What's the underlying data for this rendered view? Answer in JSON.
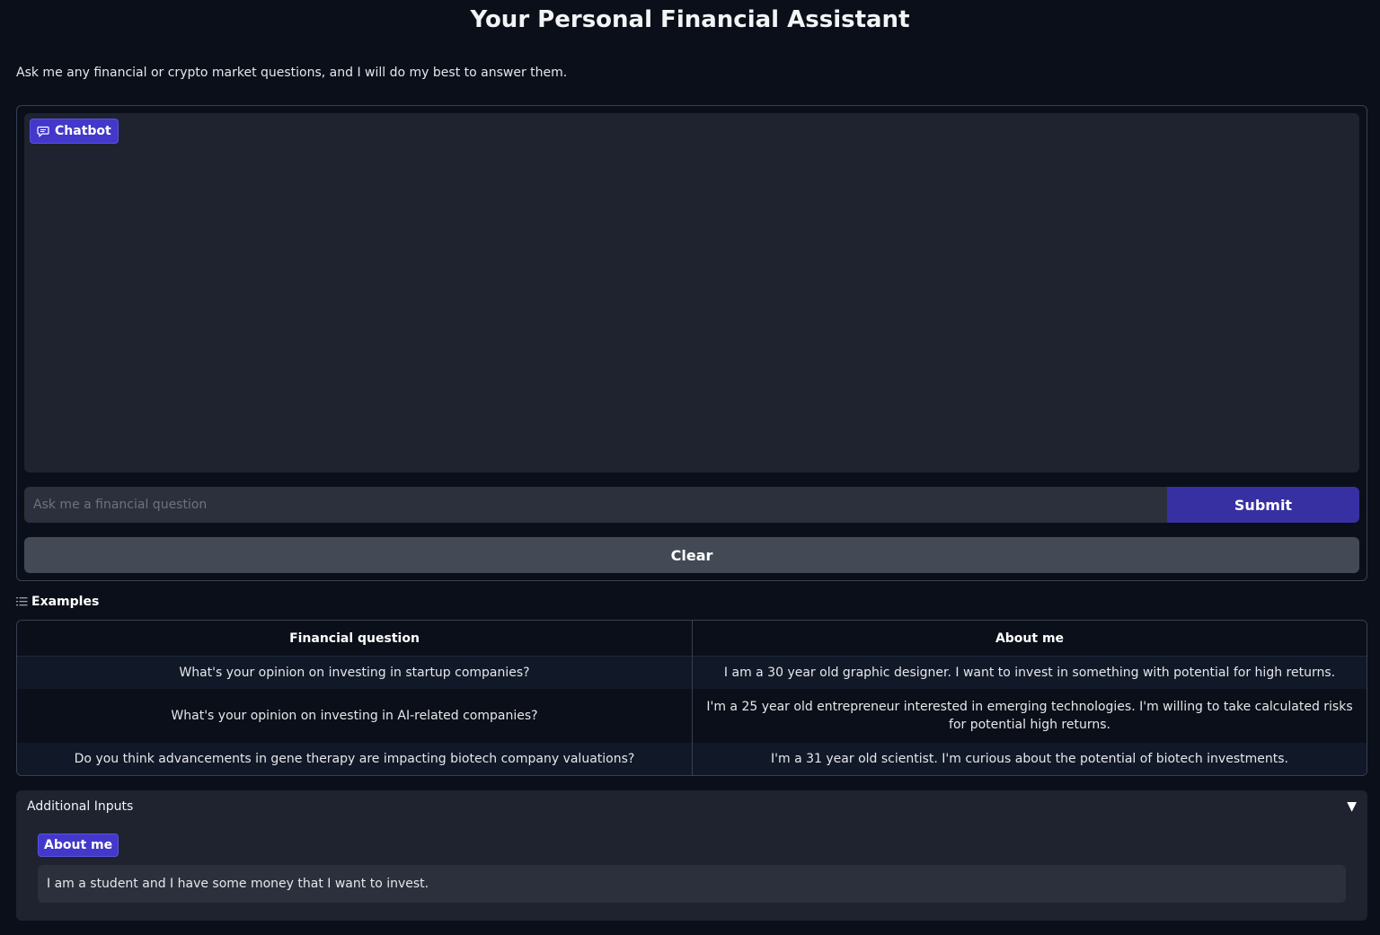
{
  "page": {
    "title": "Your Personal Financial Assistant",
    "description": "Ask me any financial or crypto market questions, and I will do my best to answer them."
  },
  "chatbot": {
    "label": "Chatbot",
    "icon": "chat-bubble-icon"
  },
  "question_input": {
    "placeholder": "Ask me a financial question",
    "value": ""
  },
  "buttons": {
    "submit": "Submit",
    "clear": "Clear"
  },
  "examples": {
    "label": "Examples",
    "icon": "list-icon",
    "headers": [
      "Financial question",
      "About me"
    ],
    "rows": [
      [
        "What's your opinion on investing in startup companies?",
        "I am a 30 year old graphic designer. I want to invest in something with potential for high returns."
      ],
      [
        "What's your opinion on investing in AI-related companies?",
        "I'm a 25 year old entrepreneur interested in emerging technologies. I'm willing to take calculated risks for potential high returns."
      ],
      [
        "Do you think advancements in gene therapy are impacting biotech company valuations?",
        "I'm a 31 year old scientist. I'm curious about the potential of biotech investments."
      ]
    ]
  },
  "additional_inputs": {
    "label": "Additional Inputs",
    "caret": "▼",
    "about_me_label": "About me",
    "about_me_value": "I am a student and I have some money that I want to invest."
  },
  "colors": {
    "background": "#0b0f19",
    "panel": "#1f2330",
    "accent": "#4338ca",
    "submit": "#3730a3",
    "clear": "#434a56"
  }
}
